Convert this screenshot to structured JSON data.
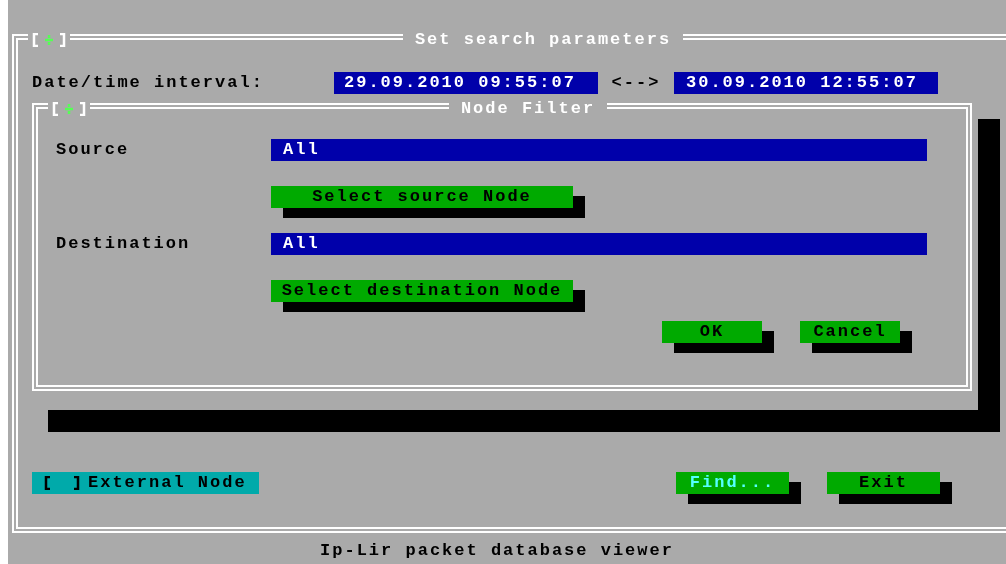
{
  "window": {
    "title": "Set search parameters"
  },
  "date_interval": {
    "label": "Date/time interval:",
    "from": "29.09.2010 09:55:07",
    "separator": "<-->",
    "to": "30.09.2010 12:55:07"
  },
  "node_filter": {
    "title": "Node Filter",
    "fields": [
      {
        "label": "Source",
        "value": "All",
        "button": "Select source Node"
      },
      {
        "label": "Destination",
        "value": "All",
        "button": "Select destination Node"
      }
    ],
    "buttons": [
      {
        "label": "OK"
      },
      {
        "label": "Cancel"
      }
    ]
  },
  "external_node": {
    "label": "External Node",
    "checked": false
  },
  "buttons": [
    {
      "label": "Find...",
      "default": true
    },
    {
      "label": "Exit",
      "default": false
    }
  ],
  "status_bar": "Ip-Lir packet database viewer"
}
